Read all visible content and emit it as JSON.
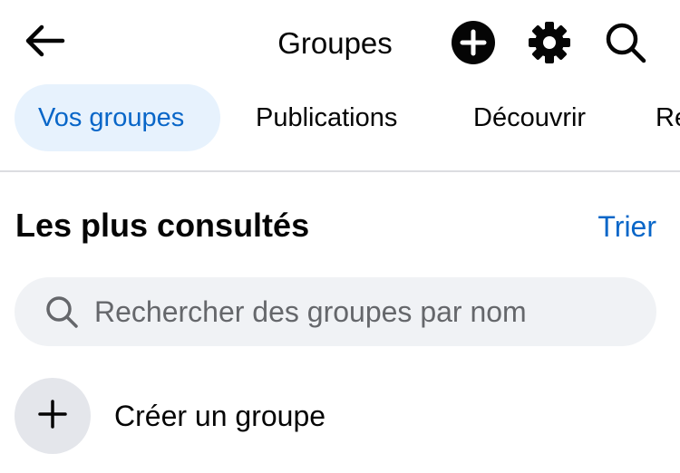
{
  "header": {
    "title": "Groupes",
    "icons": {
      "back": "arrow-left-icon",
      "add": "plus-circle-icon",
      "settings": "gear-icon",
      "search": "search-icon"
    }
  },
  "tabs": [
    {
      "label": "Vos groupes",
      "active": true
    },
    {
      "label": "Publications",
      "active": false
    },
    {
      "label": "Découvrir",
      "active": false
    },
    {
      "label": "Re",
      "active": false
    }
  ],
  "section": {
    "title": "Les plus consultés",
    "sort_label": "Trier"
  },
  "search": {
    "placeholder": "Rechercher des groupes par nom",
    "value": ""
  },
  "create": {
    "label": "Créer un groupe",
    "icon": "plus-icon"
  },
  "colors": {
    "accent": "#0866c8",
    "active_tab_bg": "#e7f2fd",
    "search_bg": "#f0f2f5",
    "circle_bg": "#e4e6eb",
    "divider": "#dcdde1"
  }
}
